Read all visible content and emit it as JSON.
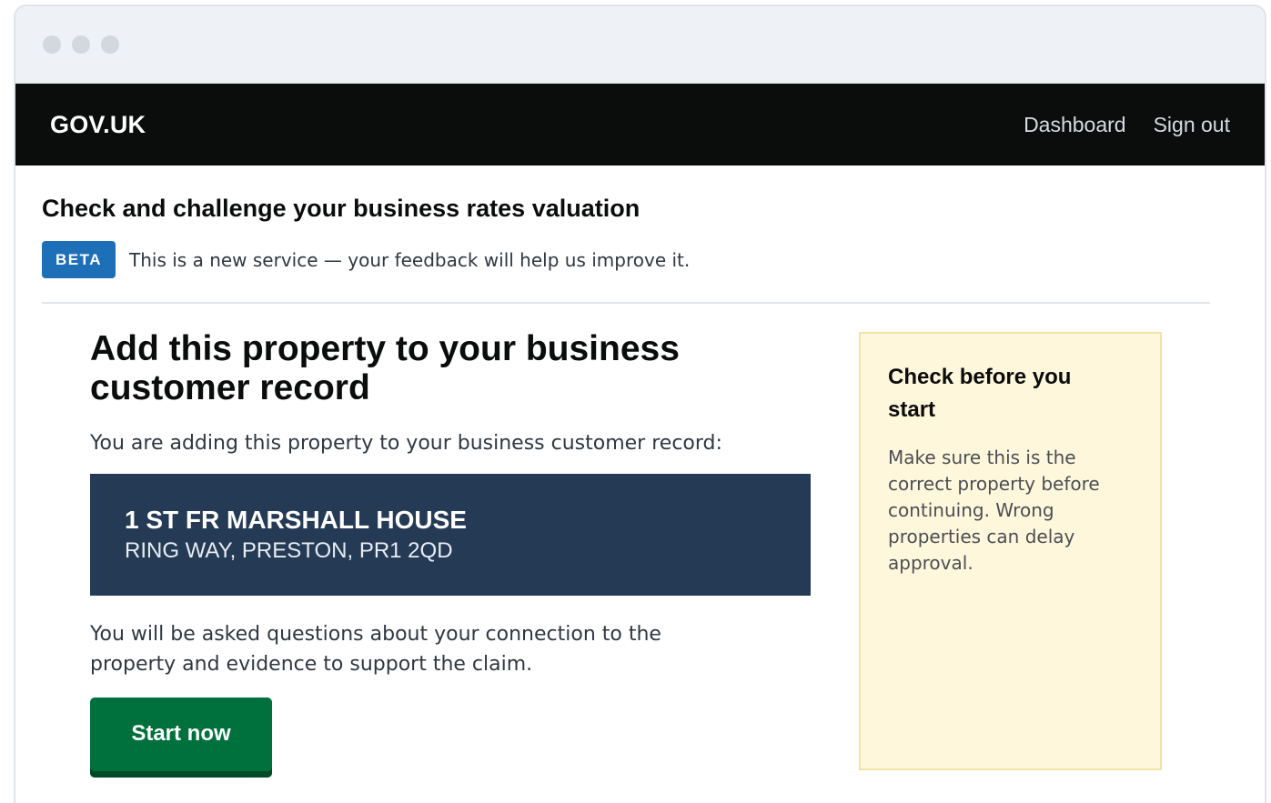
{
  "header": {
    "logo": "GOV.UK",
    "nav": [
      "Dashboard",
      "Sign out"
    ]
  },
  "service": {
    "title": "Check and challenge your business rates valuation",
    "beta_tag": "BETA",
    "beta_text": "This is a new service — your feedback will help us improve it."
  },
  "main": {
    "heading": "Add this property to your business customer record",
    "intro": "You are adding this property to your business customer record:",
    "address": {
      "line1": "1 ST FR MARSHALL HOUSE",
      "line2": "RING WAY, PRESTON, PR1 2QD"
    },
    "note": "You will be asked questions about your connection to the property and evidence to support the claim.",
    "start_button": "Start now"
  },
  "aside": {
    "title": "Check before you start",
    "text": "Make sure this is the correct property before continuing. Wrong properties can delay approval."
  },
  "colors": {
    "header_bg": "#0b0c0c",
    "beta_blue": "#1d70b8",
    "address_bg": "#253a55",
    "button_green": "#00703c",
    "aside_bg": "#fff7db"
  }
}
